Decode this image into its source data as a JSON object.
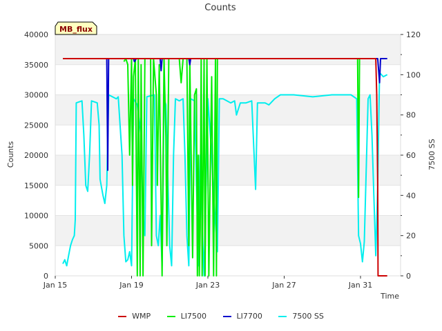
{
  "chart_data": {
    "type": "line",
    "title": "Counts",
    "xlabel": "Time",
    "ylabel": "Counts",
    "ylabel_right": "7500 SS",
    "badge": "MB_flux",
    "x_range": [
      "Jan 15",
      "Feb 2"
    ],
    "ylim": [
      0,
      40000
    ],
    "ylim_right": [
      0,
      120
    ],
    "x_ticks": [
      "Jan 15",
      "Jan 19",
      "Jan 23",
      "Jan 27",
      "Jan 31"
    ],
    "y_ticks": [
      0,
      5000,
      10000,
      15000,
      20000,
      25000,
      30000,
      35000,
      40000
    ],
    "y_ticks_right": [
      0,
      20,
      40,
      60,
      80,
      100,
      120
    ],
    "grid": "horizontal bands",
    "legend_position": "bottom",
    "colors": {
      "WMP": "#cc0000",
      "LI7500": "#00ee00",
      "LI7700": "#0000cc",
      "7500 SS": "#00eeee"
    },
    "series": [
      {
        "name": "WMP",
        "axis": "left",
        "points": [
          [
            15.4,
            36000
          ],
          [
            31.8,
            36000
          ],
          [
            31.85,
            30000
          ],
          [
            31.9,
            15000
          ],
          [
            31.92,
            0
          ],
          [
            32.4,
            0
          ]
        ]
      },
      {
        "name": "LI7500",
        "axis": "left",
        "points": [
          [
            18.6,
            35500
          ],
          [
            18.7,
            36000
          ],
          [
            18.8,
            35000
          ],
          [
            18.9,
            20000
          ],
          [
            19.0,
            36000
          ],
          [
            19.05,
            15000
          ],
          [
            19.1,
            33000
          ],
          [
            19.2,
            36000
          ],
          [
            19.3,
            0
          ],
          [
            19.35,
            36000
          ],
          [
            19.45,
            0
          ],
          [
            19.5,
            35000
          ],
          [
            19.6,
            0
          ],
          [
            19.7,
            36000
          ],
          [
            20.0,
            36000
          ],
          [
            20.05,
            5000
          ],
          [
            20.15,
            36000
          ],
          [
            20.3,
            30000
          ],
          [
            20.35,
            15000
          ],
          [
            20.45,
            35000
          ],
          [
            20.6,
            0
          ],
          [
            20.7,
            36000
          ],
          [
            20.8,
            23000
          ],
          [
            20.85,
            5000
          ],
          [
            20.95,
            36000
          ],
          [
            21.5,
            36000
          ],
          [
            21.6,
            32000
          ],
          [
            21.7,
            36000
          ],
          [
            21.9,
            36000
          ],
          [
            22.0,
            5000
          ],
          [
            22.05,
            36000
          ],
          [
            22.2,
            3000
          ],
          [
            22.3,
            30000
          ],
          [
            22.4,
            31000
          ],
          [
            22.45,
            0
          ],
          [
            22.5,
            20000
          ],
          [
            22.55,
            0
          ],
          [
            22.6,
            8000
          ],
          [
            22.65,
            36000
          ],
          [
            22.7,
            0
          ],
          [
            22.8,
            36000
          ],
          [
            22.85,
            0
          ],
          [
            22.95,
            36000
          ],
          [
            23.05,
            0
          ],
          [
            23.1,
            12000
          ],
          [
            23.2,
            33000
          ],
          [
            23.3,
            0
          ],
          [
            23.4,
            36000
          ],
          [
            23.45,
            0
          ],
          [
            23.5,
            36000
          ],
          [
            30.85,
            36000
          ],
          [
            30.9,
            13000
          ],
          [
            30.95,
            36000
          ],
          [
            31.8,
            36000
          ]
        ]
      },
      {
        "name": "LI7700",
        "axis": "left",
        "points": [
          [
            15.4,
            36000
          ],
          [
            17.7,
            36000
          ],
          [
            17.75,
            17500
          ],
          [
            17.8,
            36000
          ],
          [
            19.1,
            36000
          ],
          [
            19.15,
            35500
          ],
          [
            19.25,
            36000
          ],
          [
            20.5,
            36000
          ],
          [
            20.55,
            34000
          ],
          [
            20.6,
            36000
          ],
          [
            22.0,
            36000
          ],
          [
            22.05,
            35000
          ],
          [
            22.1,
            36000
          ],
          [
            31.9,
            36000
          ],
          [
            32.0,
            32000
          ],
          [
            32.05,
            36000
          ],
          [
            32.4,
            36000
          ]
        ]
      },
      {
        "name": "7500 SS",
        "axis": "right",
        "points": [
          [
            15.4,
            6
          ],
          [
            15.5,
            8
          ],
          [
            15.6,
            5
          ],
          [
            15.7,
            10
          ],
          [
            15.8,
            15
          ],
          [
            15.9,
            18
          ],
          [
            16.0,
            20
          ],
          [
            16.05,
            28
          ],
          [
            16.1,
            86
          ],
          [
            16.4,
            87
          ],
          [
            16.5,
            70
          ],
          [
            16.6,
            45
          ],
          [
            16.7,
            42
          ],
          [
            16.8,
            60
          ],
          [
            16.9,
            87
          ],
          [
            17.2,
            86
          ],
          [
            17.3,
            75
          ],
          [
            17.35,
            48
          ],
          [
            17.5,
            40
          ],
          [
            17.6,
            36
          ],
          [
            17.7,
            45
          ],
          [
            17.8,
            90
          ],
          [
            18.2,
            88
          ],
          [
            18.3,
            89
          ],
          [
            18.5,
            60
          ],
          [
            18.6,
            20
          ],
          [
            18.7,
            7
          ],
          [
            18.8,
            8
          ],
          [
            18.9,
            12
          ],
          [
            19.0,
            5
          ],
          [
            19.1,
            88
          ],
          [
            19.3,
            85
          ],
          [
            19.5,
            70
          ],
          [
            19.6,
            30
          ],
          [
            19.7,
            20
          ],
          [
            19.8,
            89
          ],
          [
            20.2,
            90
          ],
          [
            20.3,
            20
          ],
          [
            20.4,
            15
          ],
          [
            20.5,
            30
          ],
          [
            20.6,
            5
          ],
          [
            20.7,
            88
          ],
          [
            20.8,
            85
          ],
          [
            21.0,
            15
          ],
          [
            21.1,
            5
          ],
          [
            21.2,
            60
          ],
          [
            21.3,
            88
          ],
          [
            21.5,
            87
          ],
          [
            21.7,
            88
          ],
          [
            21.8,
            60
          ],
          [
            21.9,
            20
          ],
          [
            22.0,
            5
          ],
          [
            22.1,
            88
          ],
          [
            22.3,
            87
          ],
          [
            22.5,
            5
          ],
          [
            22.6,
            60
          ],
          [
            22.7,
            25
          ],
          [
            22.8,
            0
          ],
          [
            23.0,
            88
          ],
          [
            23.2,
            60
          ],
          [
            23.3,
            40
          ],
          [
            23.5,
            12
          ],
          [
            23.6,
            88
          ],
          [
            23.8,
            88
          ],
          [
            24.2,
            86
          ],
          [
            24.4,
            87
          ],
          [
            24.5,
            80
          ],
          [
            24.7,
            86
          ],
          [
            25.0,
            86
          ],
          [
            25.3,
            87
          ],
          [
            25.5,
            43
          ],
          [
            25.6,
            86
          ],
          [
            26.0,
            86
          ],
          [
            26.2,
            85
          ],
          [
            26.5,
            88
          ],
          [
            26.8,
            90
          ],
          [
            27.5,
            90
          ],
          [
            28.5,
            89
          ],
          [
            29.5,
            90
          ],
          [
            30.5,
            90
          ],
          [
            30.8,
            88
          ],
          [
            30.9,
            20
          ],
          [
            31.0,
            16
          ],
          [
            31.1,
            7
          ],
          [
            31.2,
            17
          ],
          [
            31.4,
            88
          ],
          [
            31.5,
            90
          ],
          [
            31.6,
            70
          ],
          [
            31.7,
            40
          ],
          [
            31.8,
            10
          ],
          [
            31.9,
            45
          ],
          [
            32.0,
            101
          ],
          [
            32.2,
            99
          ],
          [
            32.4,
            100
          ]
        ]
      }
    ]
  }
}
